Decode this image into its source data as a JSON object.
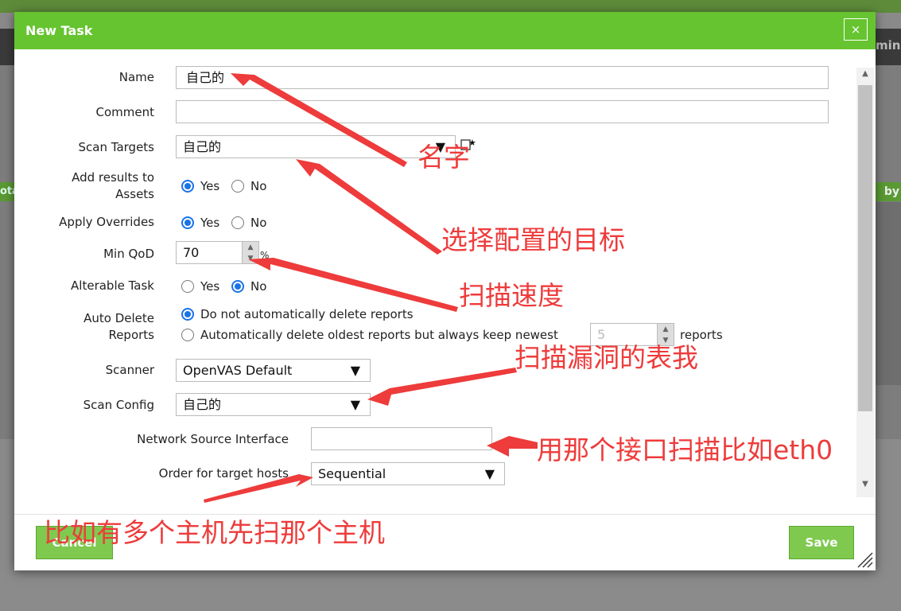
{
  "background": {
    "admin_fragment": "min",
    "left_tab_fragment": "ota",
    "right_tab_fragment": "by"
  },
  "dialog": {
    "title": "New Task",
    "close_label": "×"
  },
  "form": {
    "name": {
      "label": "Name",
      "value": "自己的"
    },
    "comment": {
      "label": "Comment",
      "value": ""
    },
    "scan_targets": {
      "label": "Scan Targets",
      "value": "自己的",
      "new_icon": "new-target-icon"
    },
    "add_results": {
      "label_line1": "Add results to",
      "label_line2": "Assets",
      "yes": "Yes",
      "no": "No",
      "selected": "Yes"
    },
    "apply_overrides": {
      "label": "Apply Overrides",
      "yes": "Yes",
      "no": "No",
      "selected": "Yes"
    },
    "min_qod": {
      "label": "Min QoD",
      "value": "70",
      "unit": "%"
    },
    "alterable": {
      "label": "Alterable Task",
      "yes": "Yes",
      "no": "No",
      "selected": "No"
    },
    "auto_delete": {
      "label_line1": "Auto Delete",
      "label_line2": "Reports",
      "option1": "Do not automatically delete reports",
      "option2": "Automatically delete oldest reports but always keep newest",
      "keep_value": "5",
      "keep_unit": "reports"
    },
    "scanner": {
      "label": "Scanner",
      "value": "OpenVAS Default"
    },
    "scan_config": {
      "label": "Scan Config",
      "value": "自己的"
    },
    "network_iface": {
      "label": "Network Source Interface",
      "value": ""
    },
    "order_hosts": {
      "label": "Order for target hosts",
      "value": "Sequential"
    }
  },
  "buttons": {
    "cancel": "Cancel",
    "save": "Save"
  },
  "annotations": {
    "name": "名字",
    "targets": "选择配置的目标",
    "qod": "扫描速度",
    "config": "扫描漏洞的表我",
    "iface": "用那个接口扫描比如eth0",
    "order": "比如有多个主机先扫那个主机"
  },
  "colors": {
    "accent": "#66c430",
    "annotation": "#ee3b3b",
    "radio": "#1a73e8"
  }
}
